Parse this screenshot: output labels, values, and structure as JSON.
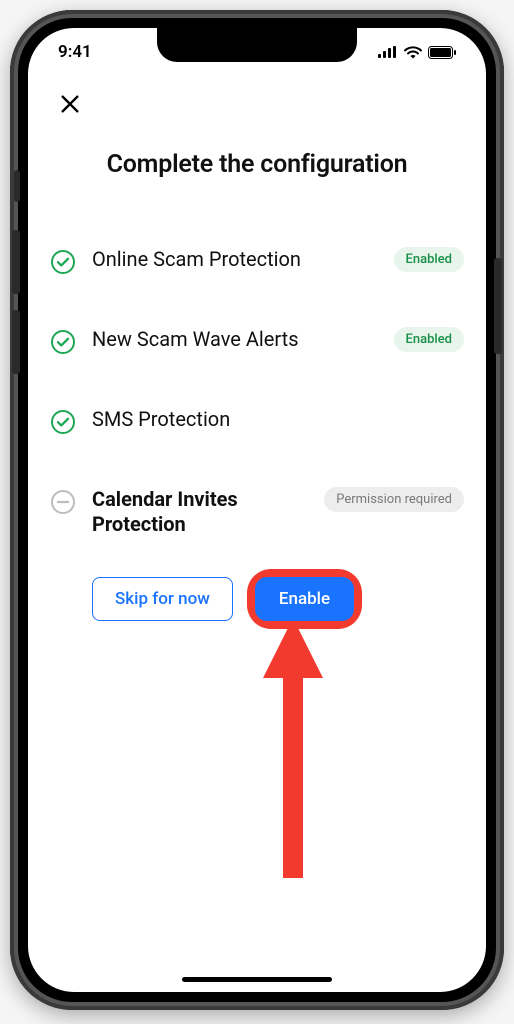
{
  "statusBar": {
    "time": "9:41"
  },
  "title": "Complete the configuration",
  "badges": {
    "enabled": "Enabled",
    "permission": "Permission required"
  },
  "items": [
    {
      "label": "Online Scam Protection",
      "status": "enabled",
      "icon": "check-circle"
    },
    {
      "label": "New Scam Wave Alerts",
      "status": "enabled",
      "icon": "check-circle"
    },
    {
      "label": "SMS Protection",
      "status": "none",
      "icon": "check-circle"
    },
    {
      "label": "Calendar Invites Protection",
      "status": "permission",
      "icon": "dash-circle",
      "active": true
    }
  ],
  "actions": {
    "skip": "Skip for now",
    "enable": "Enable"
  }
}
